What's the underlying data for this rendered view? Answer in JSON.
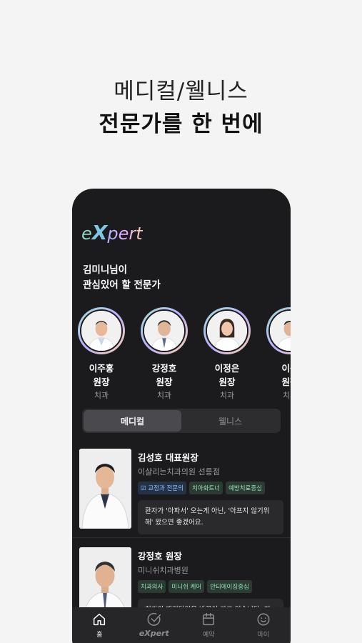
{
  "headline": {
    "line1": "메디컬/웰니스",
    "line2": "전문가를 한 번에"
  },
  "app": {
    "logo": {
      "e": "e",
      "x": "X",
      "rest": "pert"
    },
    "greeting": {
      "line1": "김미니님이",
      "line2": "관심있어 할 전문가"
    },
    "experts": [
      {
        "name": "이주홍",
        "title": "원장",
        "specialty": "치과"
      },
      {
        "name": "강정호",
        "title": "원장",
        "specialty": "치과"
      },
      {
        "name": "이정은",
        "title": "원장",
        "specialty": "치과"
      },
      {
        "name": "이상",
        "title": "원장",
        "specialty": "치과"
      }
    ],
    "segment": {
      "tabs": [
        "메디컬",
        "웰니스"
      ],
      "active": "메디컬"
    },
    "cards": [
      {
        "name": "김성호 대표원장",
        "clinic": "이샬리는치과의원 선릉점",
        "tags": [
          "교정과 전문의",
          "치아화트너",
          "예방치료중심"
        ],
        "quote": "환자가 '아파서' 오는게 아닌, '아프지 않기위해' 왔으면 좋겠어요."
      },
      {
        "name": "강정호 원장",
        "clinic": "미니쉬치과병원",
        "tags": [
          "치과의사",
          "미니쉬 케어",
          "안티에이징중심"
        ],
        "quote": "치과의 패러다임을 바꾸어 가고 있습니다. 저와 함께 건강한 치아를 지켜요."
      }
    ],
    "tabbar": [
      {
        "label": "홈",
        "icon": "home-icon",
        "active": true
      },
      {
        "label": "eXpert",
        "icon": "check-circle-icon",
        "active": false
      },
      {
        "label": "예약",
        "icon": "calendar-icon",
        "active": false
      },
      {
        "label": "마이",
        "icon": "smile-icon",
        "active": false
      }
    ]
  }
}
